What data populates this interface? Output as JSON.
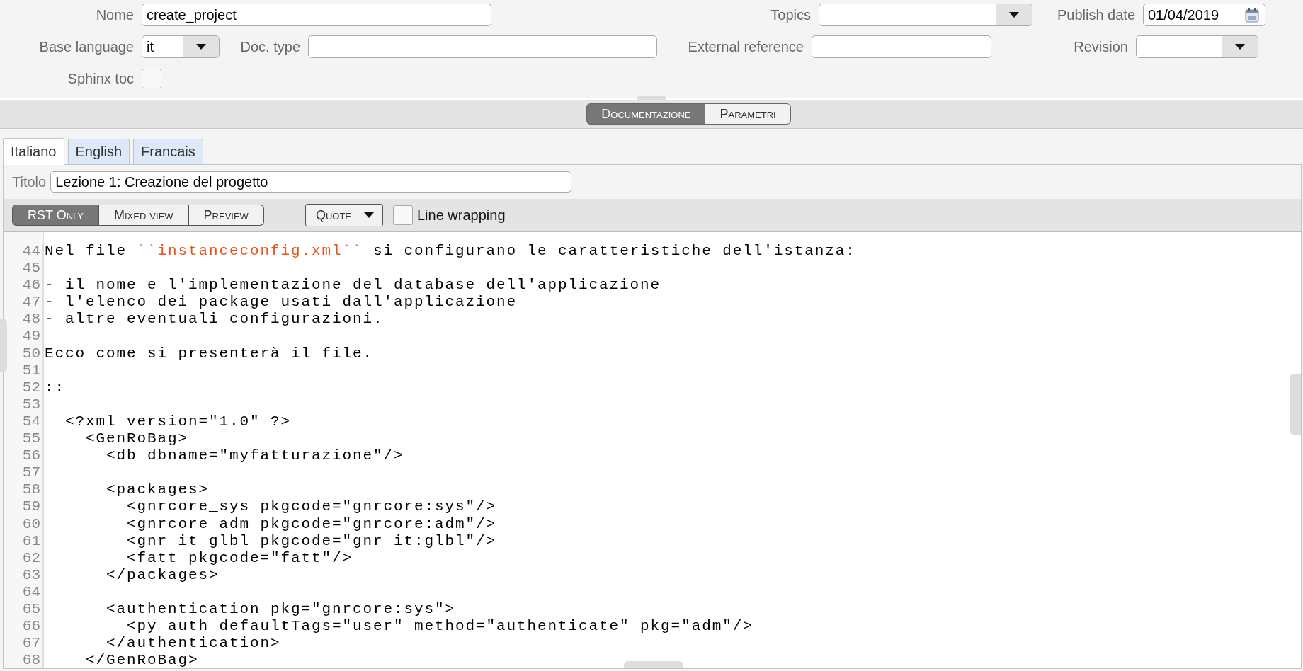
{
  "form": {
    "fields": [
      {
        "kind": "text",
        "label": "Nome",
        "value": "create_project"
      },
      {
        "kind": "select",
        "label": "Topics"
      },
      {
        "kind": "date",
        "label": "Publish date",
        "value": "01/04/2019"
      },
      {
        "kind": "select",
        "label": "Base language",
        "value": "it"
      },
      {
        "kind": "text",
        "label": "Doc. type"
      },
      {
        "kind": "text",
        "label": "External reference"
      },
      {
        "kind": "select",
        "label": "Revision"
      },
      {
        "kind": "checkbox",
        "label": "Sphinx toc",
        "checked": false
      }
    ]
  },
  "view_switch": [
    {
      "label": "Documentazione",
      "selected": true
    },
    {
      "label": "Parametri",
      "selected": false
    }
  ],
  "language_tabs": [
    {
      "label": "Italiano",
      "selected": true
    },
    {
      "label": "English",
      "selected": false
    },
    {
      "label": "Francais",
      "selected": false
    }
  ],
  "title_field": {
    "label": "Titolo",
    "value": "Lezione 1: Creazione del progetto"
  },
  "editor_modes": [
    {
      "label": "RST Only",
      "selected": true
    },
    {
      "label": "Mixed view",
      "selected": false
    },
    {
      "label": "Preview",
      "selected": false
    }
  ],
  "quote_menu": {
    "label": "Quote"
  },
  "line_wrapping": {
    "label": "Line wrapping",
    "checked": false
  },
  "editor": {
    "lines": [
      {
        "number": "44",
        "segments": [
          {
            "kind": "plain",
            "text": "Nel file "
          },
          {
            "kind": "literal",
            "text": "``instanceconfig.xml``"
          },
          {
            "kind": "plain",
            "text": " si configurano le caratteristiche dell'istanza:"
          }
        ]
      },
      {
        "number": "45"
      },
      {
        "number": "46",
        "text": "- il nome e l'implementazione del database dell'applicazione"
      },
      {
        "number": "47",
        "text": "- l'elenco dei package usati dall'applicazione"
      },
      {
        "number": "48",
        "text": "- altre eventuali configurazioni."
      },
      {
        "number": "49"
      },
      {
        "number": "50",
        "text": "Ecco come si presenterà il file."
      },
      {
        "number": "51"
      },
      {
        "number": "52",
        "text": "::"
      },
      {
        "number": "53"
      },
      {
        "number": "54",
        "text": "  <?xml version=\"1.0\" ?>"
      },
      {
        "number": "55",
        "text": "    <GenRoBag>"
      },
      {
        "number": "56",
        "text": "      <db dbname=\"myfatturazione\"/>"
      },
      {
        "number": "57"
      },
      {
        "number": "58",
        "text": "      <packages>"
      },
      {
        "number": "59",
        "text": "        <gnrcore_sys pkgcode=\"gnrcore:sys\"/>"
      },
      {
        "number": "60",
        "text": "        <gnrcore_adm pkgcode=\"gnrcore:adm\"/>"
      },
      {
        "number": "61",
        "text": "        <gnr_it_glbl pkgcode=\"gnr_it:glbl\"/>"
      },
      {
        "number": "62",
        "text": "        <fatt pkgcode=\"fatt\"/>"
      },
      {
        "number": "63",
        "text": "      </packages>"
      },
      {
        "number": "64"
      },
      {
        "number": "65",
        "text": "      <authentication pkg=\"gnrcore:sys\">"
      },
      {
        "number": "66",
        "text": "        <py_auth defaultTags=\"user\" method=\"authenticate\" pkg=\"adm\"/>"
      },
      {
        "number": "67",
        "text": "      </authentication>"
      },
      {
        "number": "68",
        "text": "    </GenRoBag>"
      }
    ]
  }
}
